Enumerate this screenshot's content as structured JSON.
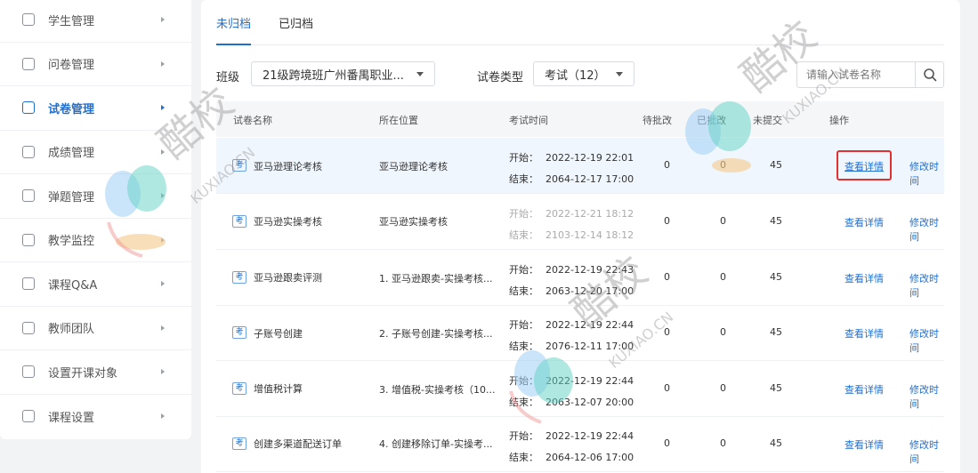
{
  "sidebar": {
    "items": [
      {
        "label": "学生管理",
        "icon": "student-icon"
      },
      {
        "label": "问卷管理",
        "icon": "questionnaire-icon"
      },
      {
        "label": "试卷管理",
        "icon": "exam-paper-icon",
        "active": true
      },
      {
        "label": "成绩管理",
        "icon": "grades-icon"
      },
      {
        "label": "弹题管理",
        "icon": "popup-question-icon"
      },
      {
        "label": "教学监控",
        "icon": "monitor-icon"
      },
      {
        "label": "课程Q&A",
        "icon": "qa-icon"
      },
      {
        "label": "教师团队",
        "icon": "team-icon"
      },
      {
        "label": "设置开课对象",
        "icon": "target-icon"
      },
      {
        "label": "课程设置",
        "icon": "settings-icon"
      }
    ]
  },
  "tabs": [
    {
      "label": "未归档",
      "active": true
    },
    {
      "label": "已归档",
      "active": false
    }
  ],
  "filters": {
    "class_label": "班级",
    "class_value": "21级跨境班广州番禺职业...",
    "type_label": "试卷类型",
    "type_value": "考试（12）",
    "search_placeholder": "请输入试卷名称"
  },
  "table": {
    "headers": [
      "试卷名称",
      "所在位置",
      "考试时间",
      "待批改",
      "已批改",
      "未提交",
      "操作"
    ],
    "start_prefix": "开始：",
    "end_prefix": "结束：",
    "badge": "考",
    "view_label": "查看详情",
    "edit_label": "修改时间",
    "rows": [
      {
        "name": "亚马逊理论考核",
        "location": "亚马逊理论考核",
        "start": "2022-12-19 22:01",
        "end": "2064-12-17 17:00",
        "pending": "0",
        "graded": "0",
        "unsubmitted": "45",
        "highlight": true
      },
      {
        "name": "亚马逊实操考核",
        "location": "亚马逊实操考核",
        "start": "2022-12-21 18:12",
        "end": "2103-12-14 18:12",
        "pending": "0",
        "graded": "0",
        "unsubmitted": "45",
        "muted": true
      },
      {
        "name": "亚马逊跟卖评测",
        "location": "1. 亚马逊跟卖-实操考核...",
        "start": "2022-12-19 22:43",
        "end": "2063-12-20 17:00",
        "pending": "0",
        "graded": "0",
        "unsubmitted": "45"
      },
      {
        "name": "子账号创建",
        "location": "2. 子账号创建-实操考核...",
        "start": "2022-12-19 22:44",
        "end": "2076-12-11 17:00",
        "pending": "0",
        "graded": "0",
        "unsubmitted": "45"
      },
      {
        "name": "增值税计算",
        "location": "3. 增值税-实操考核（10...",
        "start": "2022-12-19 22:44",
        "end": "2063-12-07 20:00",
        "pending": "0",
        "graded": "0",
        "unsubmitted": "45"
      },
      {
        "name": "创建多渠道配送订单",
        "location": "4. 创建移除订单-实操考...",
        "start": "2022-12-19 22:44",
        "end": "2064-12-06 17:00",
        "pending": "0",
        "graded": "0",
        "unsubmitted": "45"
      }
    ]
  },
  "watermark": {
    "brand": "酷校",
    "domain": "KUXIAO.CN"
  },
  "colors": {
    "accent": "#1f6fd1",
    "highlight_border": "#e03030"
  }
}
